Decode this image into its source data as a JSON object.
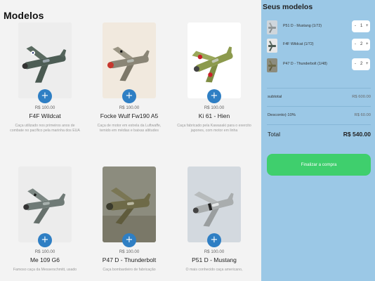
{
  "catalog": {
    "title": "Modelos",
    "add_label": "+",
    "products": [
      {
        "name": "F4F Wildcat",
        "price": "R$ 100.00",
        "desc": "Caça utilizado nos primeiros anos de combate no pacífico pela marinha dos EUA"
      },
      {
        "name": "Focke Wulf Fw190 A5",
        "price": "R$ 100.00",
        "desc": "Caça de motor em estrela da Luftwaffe, temido em médias e baixas altitudes"
      },
      {
        "name": "Ki 61 - Hien",
        "price": "R$ 100.00",
        "desc": "Caça fabricado pela Kawasaki para o exercito japones, com motor em linha"
      },
      {
        "name": "Me 109 G6",
        "price": "R$ 100.00",
        "desc": "Famoso caça da Messerschmitt, usado"
      },
      {
        "name": "P47 D - Thunderbolt",
        "price": "R$ 100.00",
        "desc": "Caça bombardeiro de fabricação"
      },
      {
        "name": "P51 D - Mustang",
        "price": "R$ 100.00",
        "desc": "O mais conhecido caça americano,"
      }
    ]
  },
  "cart": {
    "title": "Seus modelos",
    "items": [
      {
        "name": "P51 D - Mustang (1/72)",
        "qty": "1"
      },
      {
        "name": "F4F Wildcat (1/72)",
        "qty": "2"
      },
      {
        "name": "P47 D - Thunderbolt (1/48)",
        "qty": "2"
      }
    ],
    "minus": "-",
    "plus": "+",
    "subtotal_label": "subtotal",
    "subtotal_value": "R$ 600.00",
    "discount_label": "Desconto(-10%",
    "discount_value": "R$ 60.00",
    "total_label": "Total",
    "total_value": "R$ 540.00",
    "checkout_label": "Finalizar a compra"
  },
  "colors": {
    "accent": "#2f7fc4",
    "sidebar_bg": "#9bc8e6",
    "checkout": "#3fcf6d"
  }
}
